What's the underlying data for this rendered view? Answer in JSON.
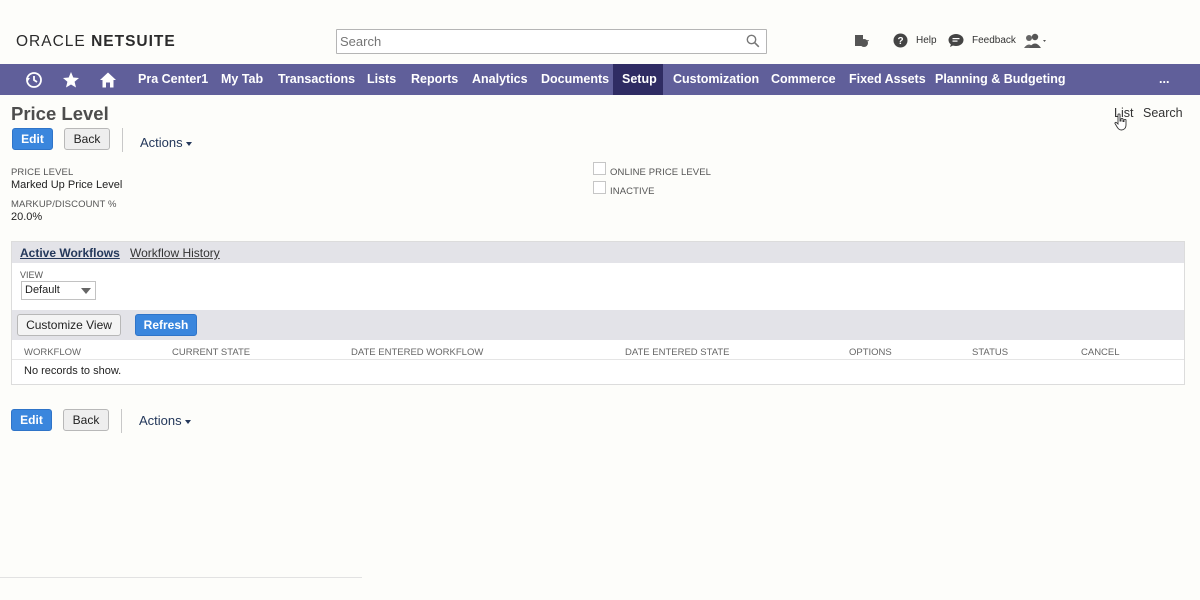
{
  "header": {
    "logo_prefix": "ORACLE",
    "logo_brand": "NETSUITE",
    "search_placeholder": "Search",
    "help_label": "Help",
    "feedback_label": "Feedback"
  },
  "nav": {
    "items": [
      {
        "label": "Pra Center1"
      },
      {
        "label": "My Tab"
      },
      {
        "label": "Transactions"
      },
      {
        "label": "Lists"
      },
      {
        "label": "Reports"
      },
      {
        "label": "Analytics"
      },
      {
        "label": "Documents"
      },
      {
        "label": "Setup",
        "active": true
      },
      {
        "label": "Customization"
      },
      {
        "label": "Commerce"
      },
      {
        "label": "Fixed Assets"
      },
      {
        "label": "Planning & Budgeting"
      }
    ],
    "more_label": "..."
  },
  "page": {
    "title": "Price Level",
    "links": {
      "list": "List",
      "search": "Search"
    }
  },
  "toolbar": {
    "edit_label": "Edit",
    "back_label": "Back",
    "actions_label": "Actions"
  },
  "fields": {
    "price_level_label": "PRICE LEVEL",
    "price_level_value": "Marked Up Price Level",
    "markup_label": "MARKUP/DISCOUNT %",
    "markup_value": "20.0%",
    "online_price_level_label": "ONLINE PRICE LEVEL",
    "online_price_level_checked": false,
    "inactive_label": "INACTIVE",
    "inactive_checked": false
  },
  "workflows": {
    "tabs": [
      {
        "label": "Active Workflows",
        "active": true
      },
      {
        "label": "Workflow History",
        "active": false
      }
    ],
    "view_label": "VIEW",
    "view_value": "Default",
    "customize_view_label": "Customize View",
    "refresh_label": "Refresh",
    "columns": [
      "WORKFLOW",
      "CURRENT STATE",
      "DATE ENTERED WORKFLOW",
      "DATE ENTERED STATE",
      "OPTIONS",
      "STATUS",
      "CANCEL"
    ],
    "empty_message": "No records to show."
  },
  "colors": {
    "nav_bg": "#605f9a",
    "nav_active": "#2f2c63",
    "primary_button": "#3a86dd"
  }
}
